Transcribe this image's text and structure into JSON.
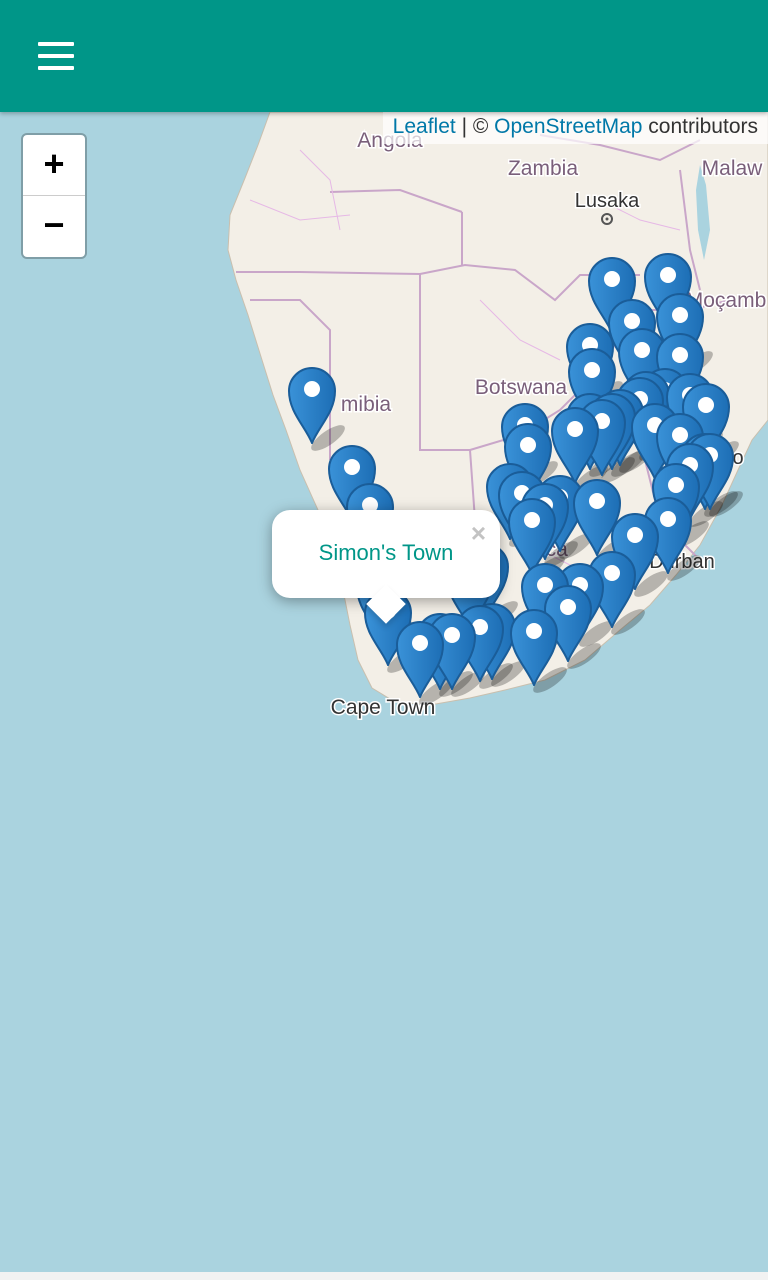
{
  "app": {
    "accent_color": "#009688",
    "menu_icon": "hamburger-menu-icon"
  },
  "map": {
    "attribution": {
      "leaflet": "Leaflet",
      "separator": " | © ",
      "osm": "OpenStreetMap",
      "suffix": " contributors"
    },
    "zoom": {
      "in_label": "+",
      "out_label": "−"
    },
    "labels": {
      "angola": "Angola",
      "zambia": "Zambia",
      "lusaka": "Lusaka",
      "malawi": "Malaw",
      "mozambique": "Moçamb",
      "namibia": "mibia",
      "botswana": "Botswana",
      "maputo": "o",
      "africa": "frica",
      "durban": "Durban",
      "cape_town": "Cape Town"
    },
    "popup": {
      "title": "Simon's Town",
      "close_label": "×"
    },
    "marker_color": "#2a81cb"
  }
}
